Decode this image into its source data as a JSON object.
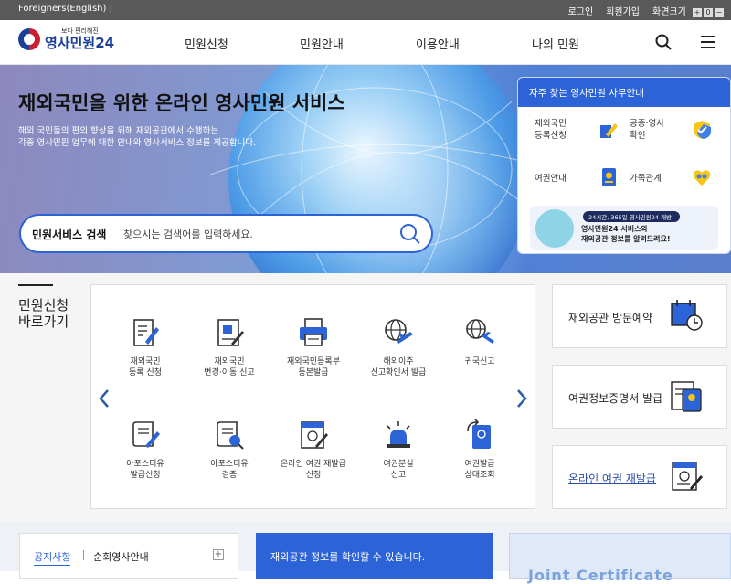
{
  "utility": {
    "language": "Foreigners(English) |",
    "login": "로그인",
    "signup": "회원가입",
    "font_size": "화면크기",
    "font_size_buttons": [
      "+",
      "0",
      "−"
    ]
  },
  "header": {
    "logo_small": "보다 편리해진",
    "logo_main": "영사민원24",
    "menu": [
      "민원신청",
      "민원안내",
      "이용안내",
      "나의 민원"
    ],
    "search_icon": "search-icon",
    "menu_icon": "hamburger-menu-icon"
  },
  "hero": {
    "title": "재외국민을 위한 온라인 영사민원 서비스",
    "desc_line1": "해외 국민들의 편의 향상을 위해 재외공관에서 수행하는",
    "desc_line2": "각종 영사민원 업무에 대한 안내와 영사서비스 정보를 제공합니다.",
    "search_label": "민원서비스 검색",
    "search_placeholder": "찾으시는 검색어를 입력하세요."
  },
  "panel": {
    "title": "자주 찾는 영사민원 사무안내",
    "items": [
      {
        "line1": "재외국민",
        "line2": "등록신청",
        "icon": "pen-document-icon"
      },
      {
        "line1": "공증·영사",
        "line2": "확인",
        "icon": "shield-check-icon"
      },
      {
        "line1": "여권안내",
        "line2": "",
        "icon": "passport-icon"
      },
      {
        "line1": "가족관계",
        "line2": "",
        "icon": "family-heart-icon"
      }
    ],
    "banner_pill": "24시간, 365일 영사민원24 개방!",
    "banner_line1": "영사민원24 서비스와",
    "banner_line2": "재외공관 정보를 알려드려요!"
  },
  "shortcuts": {
    "title_line1": "민원신청",
    "title_line2": "바로가기",
    "items": [
      {
        "line1": "재외국민",
        "line2": "등록 신청",
        "icon": "registration-form-icon"
      },
      {
        "line1": "재외국민",
        "line2": "변경·이동 신고",
        "icon": "change-report-icon"
      },
      {
        "line1": "재외국민등록부",
        "line2": "등본발급",
        "icon": "printer-icon"
      },
      {
        "line1": "해외이주",
        "line2": "신고확인서 발급",
        "icon": "globe-plane-icon"
      },
      {
        "line1": "귀국신고",
        "line2": "",
        "icon": "globe-return-icon"
      },
      {
        "line1": "아포스티유",
        "line2": "발급신청",
        "icon": "apostille-scroll-icon"
      },
      {
        "line1": "아포스티유",
        "line2": "검증",
        "icon": "apostille-verify-icon"
      },
      {
        "line1": "온라인 여권 재발급",
        "line2": "신청",
        "icon": "online-passport-icon"
      },
      {
        "line1": "여권분실",
        "line2": "신고",
        "icon": "alarm-light-icon"
      },
      {
        "line1": "여권발급",
        "line2": "상태조회",
        "icon": "passport-status-icon"
      }
    ]
  },
  "right_cards": [
    {
      "label": "재외공관 방문예약",
      "icon": "calendar-clock-icon"
    },
    {
      "label": "여권정보증명서 발급",
      "icon": "passport-certificate-icon"
    },
    {
      "label": "온라인 여권 재발급",
      "icon": "online-passport-reissue-icon"
    }
  ],
  "bottom": {
    "tab_notice": "공지사항",
    "tab_consul": "순회영사안내",
    "more": "+",
    "blue_text": "재외공관 정보를 확인할 수 있습니다.",
    "right_text": "Joint Certificate"
  },
  "colors": {
    "primary": "#2c63d6",
    "dark_bar": "#595959",
    "navy": "#1a3f9a"
  }
}
